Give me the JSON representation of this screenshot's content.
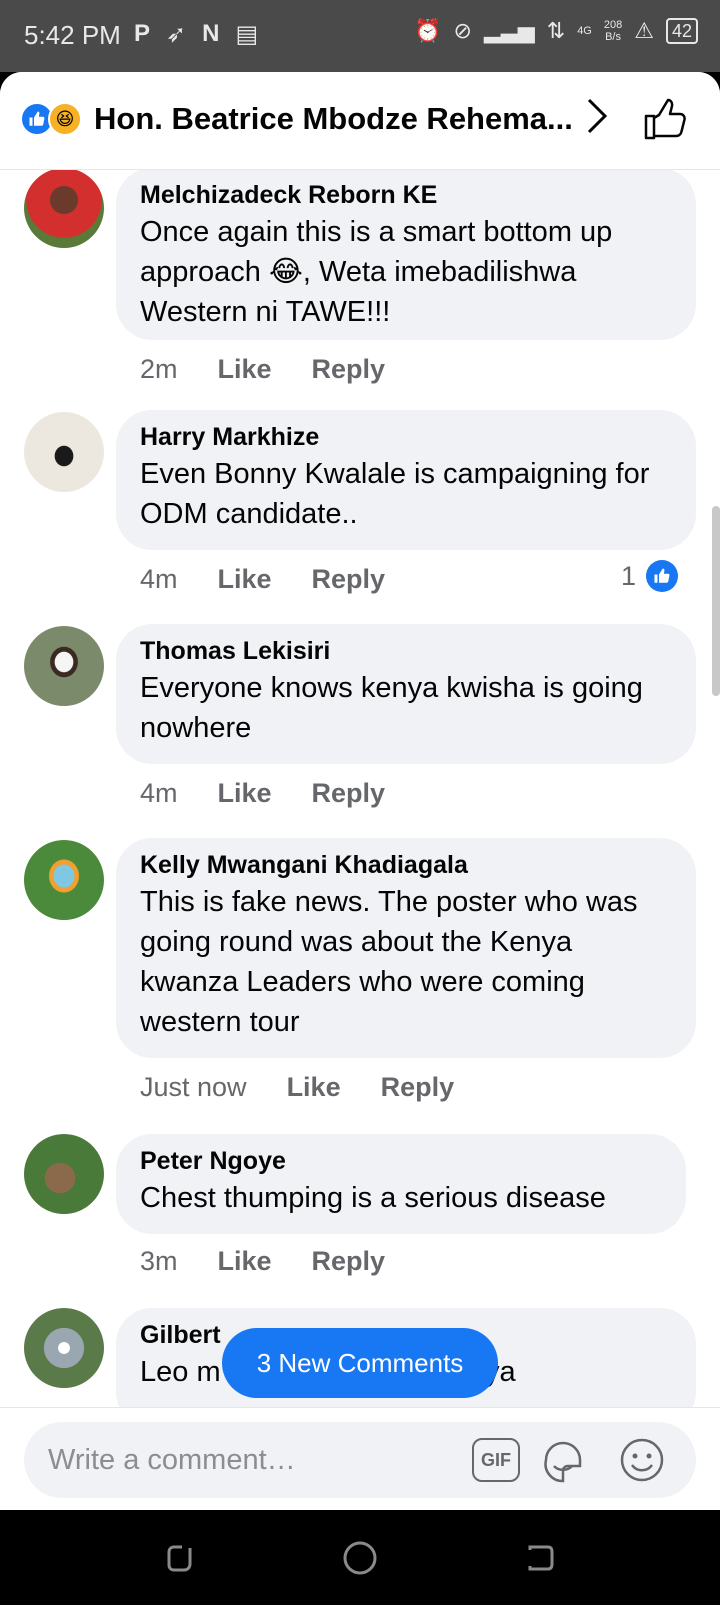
{
  "status_bar": {
    "time": "5:42 PM",
    "left_icons": [
      "P",
      "N"
    ],
    "network_label": "4G",
    "speed_value": "208",
    "speed_unit": "B/s",
    "battery": "42"
  },
  "header": {
    "title": "Hon. Beatrice Mbodze Rehema...",
    "reactions": [
      "like-reaction",
      "haha-reaction"
    ]
  },
  "comments": [
    {
      "author": "Melchizadeck Reborn KE",
      "text": "Once again this is a smart bottom up approach 😂, Weta imebadilishwa Western ni TAWE!!!",
      "time": "2m",
      "like": "Like",
      "reply": "Reply"
    },
    {
      "author": "Harry Markhize",
      "text": "Even Bonny Kwalale is campaigning for ODM candidate..",
      "time": "4m",
      "like": "Like",
      "reply": "Reply",
      "like_count": "1"
    },
    {
      "author": "Thomas Lekisiri",
      "text": "Everyone knows kenya kwisha is going nowhere",
      "time": "4m",
      "like": "Like",
      "reply": "Reply"
    },
    {
      "author": "Kelly Mwangani Khadiagala",
      "text": "This is fake news. The poster who was going round was about the Kenya kwanza Leaders who were coming western tour",
      "time": "Just now",
      "like": "Like",
      "reply": "Reply"
    },
    {
      "author": "Peter Ngoye",
      "text": "Chest thumping is a serious disease",
      "time": "3m",
      "like": "Like",
      "reply": "Reply"
    },
    {
      "author": "Gilbert",
      "text": "Leo m                    gea juu ya"
    }
  ],
  "new_comments_pill": "3 New Comments",
  "composer": {
    "placeholder": "Write a comment…",
    "gif_label": "GIF"
  },
  "colors": {
    "accent": "#1877f2",
    "bubble": "#f0f2f5",
    "meta_text": "#65676b"
  }
}
